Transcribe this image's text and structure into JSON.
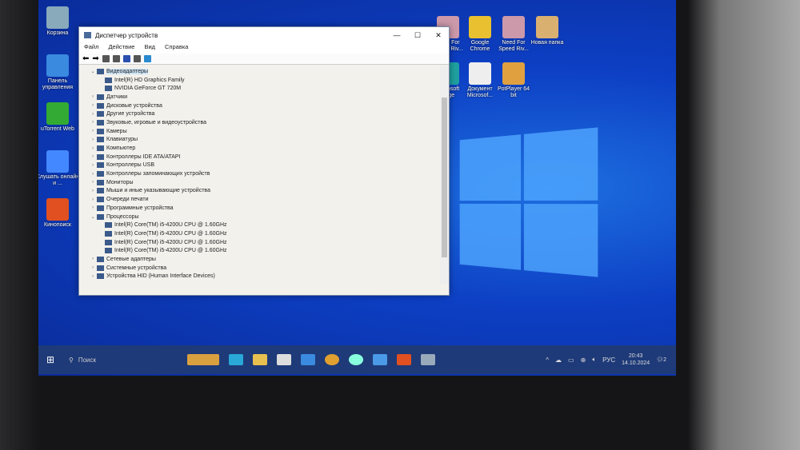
{
  "desktop": {
    "icons_left": [
      "Корзина",
      "Панель управления",
      "uTorrent Web",
      "Слушать онлайн и ...",
      "Кинопоиск"
    ],
    "icons_right": [
      "Need For Speed Riv...",
      "Google Chrome",
      "Need For Speed Riv...",
      "Новая папка",
      "Microsoft Edge",
      "Документ Microsof...",
      "PotPlayer 64 bit"
    ]
  },
  "window": {
    "title": "Диспетчер устройств",
    "menu": [
      "Файл",
      "Действие",
      "Вид",
      "Справка"
    ],
    "tree": [
      {
        "label": "Видеоадаптеры",
        "expanded": true,
        "selected": true,
        "children": [
          "Intel(R) HD Graphics Family",
          "NVIDIA GeForce GT 720M"
        ]
      },
      {
        "label": "Датчики"
      },
      {
        "label": "Дисковые устройства"
      },
      {
        "label": "Другие устройства"
      },
      {
        "label": "Звуковые, игровые и видеоустройства"
      },
      {
        "label": "Камеры"
      },
      {
        "label": "Клавиатуры"
      },
      {
        "label": "Компьютер"
      },
      {
        "label": "Контроллеры IDE ATA/ATAPI"
      },
      {
        "label": "Контроллеры USB"
      },
      {
        "label": "Контроллеры запоминающих устройств"
      },
      {
        "label": "Мониторы"
      },
      {
        "label": "Мыши и иные указывающие устройства"
      },
      {
        "label": "Очереди печати"
      },
      {
        "label": "Программные устройства"
      },
      {
        "label": "Процессоры",
        "expanded": true,
        "children": [
          "Intel(R) Core(TM) i5-4200U CPU @ 1.60GHz",
          "Intel(R) Core(TM) i5-4200U CPU @ 1.60GHz",
          "Intel(R) Core(TM) i5-4200U CPU @ 1.60GHz",
          "Intel(R) Core(TM) i5-4200U CPU @ 1.60GHz"
        ]
      },
      {
        "label": "Сетевые адаптеры"
      },
      {
        "label": "Системные устройства"
      },
      {
        "label": "Устройства HID (Human Interface Devices)"
      }
    ]
  },
  "taskbar": {
    "search_placeholder": "Поиск",
    "lang": "РУС",
    "time": "20:43",
    "date": "14.10.2024",
    "notifications": "2"
  }
}
